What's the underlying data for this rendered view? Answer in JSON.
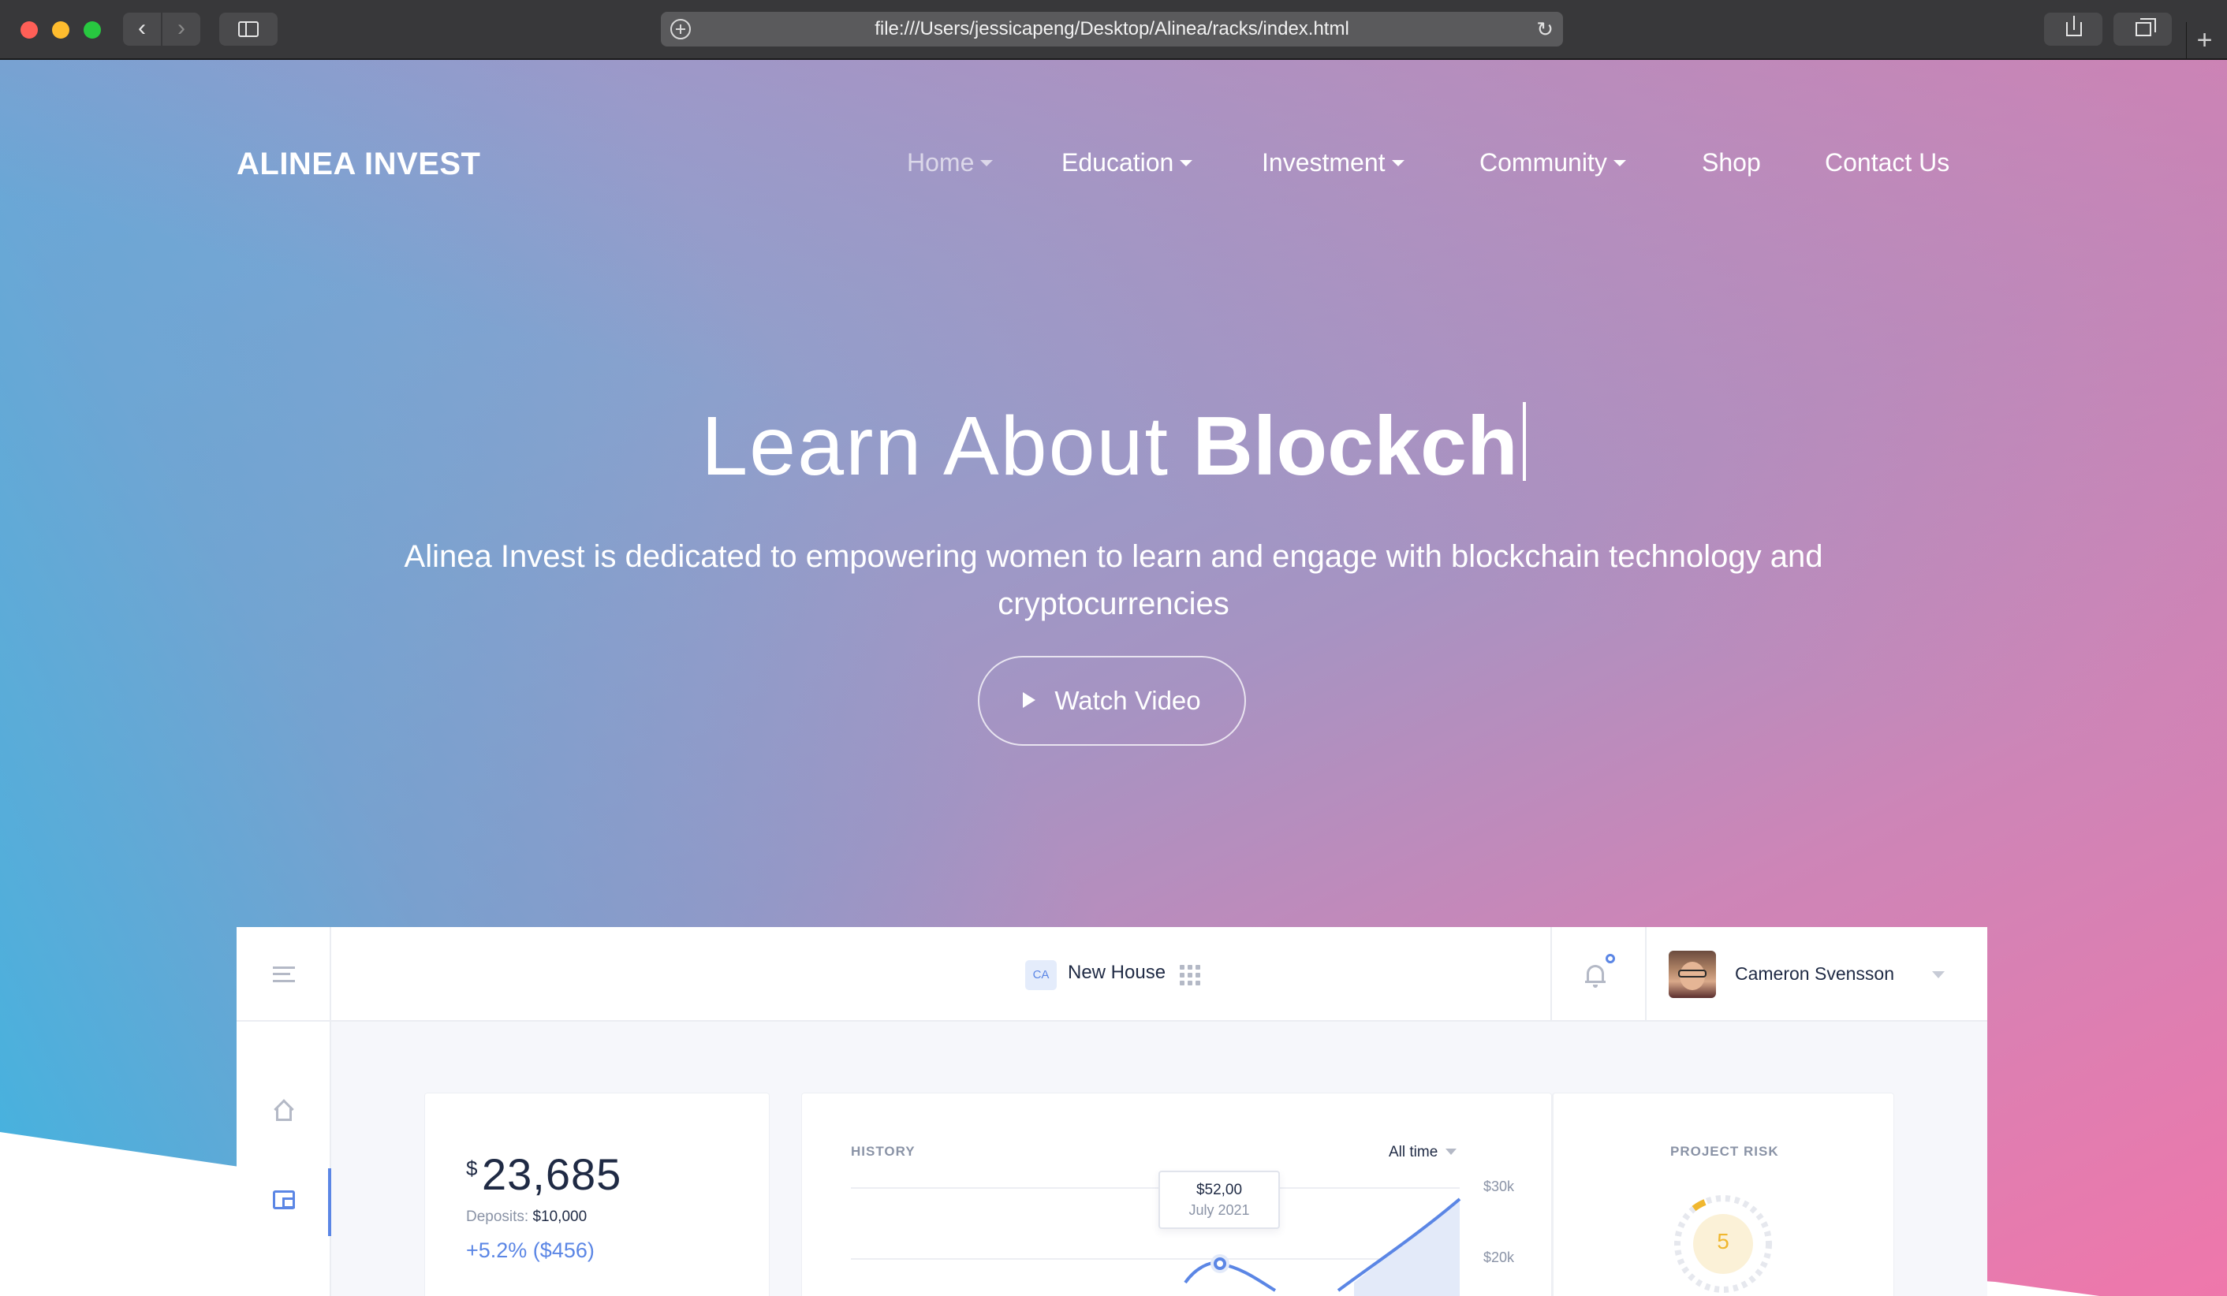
{
  "browser": {
    "url": "file:///Users/jessicapeng/Desktop/Alinea/racks/index.html"
  },
  "site": {
    "logo": "ALINEA INVEST",
    "nav": [
      {
        "label": "Home",
        "dropdown": true,
        "active": true
      },
      {
        "label": "Education",
        "dropdown": true
      },
      {
        "label": "Investment",
        "dropdown": true
      },
      {
        "label": "Community",
        "dropdown": true
      },
      {
        "label": "Shop",
        "dropdown": false
      },
      {
        "label": "Contact Us",
        "dropdown": false
      }
    ]
  },
  "hero": {
    "title_light": "Learn About",
    "title_bold": "Blockch",
    "subtitle": "Alinea Invest is dedicated to empowering women to learn and engage with blockchain technology and cryptocurrencies",
    "cta_label": "Watch Video"
  },
  "dashboard": {
    "project_badge": "CA",
    "project_name": "New House",
    "user_name": "Cameron Svensson",
    "balance": {
      "currency": "$",
      "amount": "23,685",
      "deposits_label": "Deposits:",
      "deposits_value": "$10,000",
      "change": "+5.2% ($456)"
    },
    "history": {
      "title": "HISTORY",
      "range": "All time",
      "tooltip_value": "$52,00",
      "tooltip_date": "July 2021",
      "y_labels": [
        "$30k",
        "$20k"
      ]
    },
    "risk": {
      "title": "PROJECT RISK",
      "value": "5"
    }
  },
  "colors": {
    "accent": "#5b86e5",
    "risk": "#f0b72f"
  }
}
